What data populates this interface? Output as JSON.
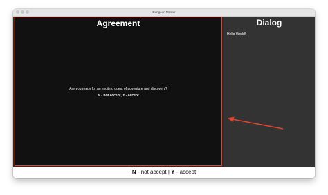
{
  "window": {
    "title": "Dungeon Master"
  },
  "agreement": {
    "heading": "Agreement",
    "question": "Are you ready for an exciting quest of adventure and discovery?",
    "hint": "N - not accept, Y - accept"
  },
  "dialog": {
    "heading": "Dialog",
    "message": "Hello World!"
  },
  "statusbar": {
    "key_n": "N",
    "text_n": " - not accept | ",
    "key_y": "Y",
    "text_y": " - accept"
  },
  "colors": {
    "highlight": "#e0452f",
    "agreement_bg": "#111111",
    "dialog_bg": "#333333"
  }
}
